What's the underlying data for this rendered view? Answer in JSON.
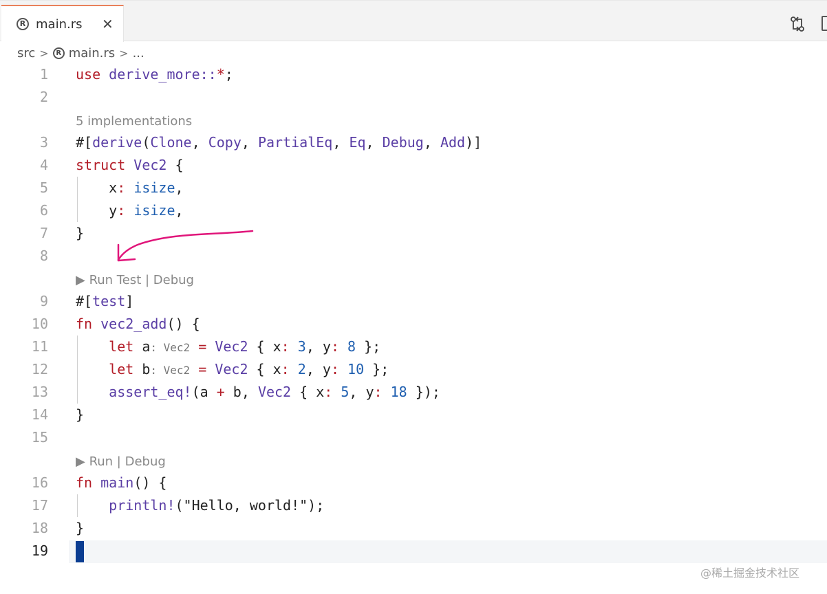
{
  "tab": {
    "icon": "rust-file-icon",
    "label": "main.rs",
    "close": "✕"
  },
  "breadcrumb": {
    "folder": "src",
    "file": "main.rs",
    "more": "..."
  },
  "lens": {
    "impls": "5 implementations",
    "run_test": "▶ Run Test | Debug",
    "run": "▶ Run | Debug"
  },
  "lines": [
    "1",
    "2",
    "3",
    "4",
    "5",
    "6",
    "7",
    "8",
    "9",
    "10",
    "11",
    "12",
    "13",
    "14",
    "15",
    "16",
    "17",
    "18",
    "19"
  ],
  "code": {
    "l1_kw": "use",
    "l1_rest": " derive_more::",
    "l1_star": "*",
    "l1_end": ";",
    "l3_hash": "#[",
    "l3_derive": "derive",
    "l3_open": "(",
    "l3_clone": "Clone",
    "l3_copy": "Copy",
    "l3_peq": "PartialEq",
    "l3_eq": "Eq",
    "l3_debug": "Debug",
    "l3_add": "Add",
    "l3_close": ")]",
    "l4_kw": "struct",
    "l4_ty": "Vec2",
    "l4_brace": " {",
    "l5_field": "    x",
    "l5_type": "isize",
    "l6_field": "    y",
    "l6_type": "isize",
    "l7": "}",
    "l9_hash": "#[",
    "l9_attr": "test",
    "l9_close": "]",
    "l10_kw": "fn",
    "l10_name": "vec2_add",
    "l10_rest": "() {",
    "l11_kw": "let",
    "l11_var": "a",
    "l11_hint": "Vec2",
    "l11_ty": "Vec2",
    "l11_x": "3",
    "l11_y": "8",
    "l12_kw": "let",
    "l12_var": "b",
    "l12_hint": "Vec2",
    "l12_ty": "Vec2",
    "l12_x": "2",
    "l12_y": "10",
    "l13_mac": "assert_eq!",
    "l13_ty": "Vec2",
    "l13_x": "5",
    "l13_y": "18",
    "l14": "}",
    "l16_kw": "fn",
    "l16_name": "main",
    "l16_rest": "() {",
    "l17_mac": "println!",
    "l17_str": "(\"Hello, world!\");",
    "l18": "}"
  },
  "watermark": "@稀土掘金技术社区",
  "colors": {
    "tab_accent": "#e9805a",
    "cursor": "#0b3d91",
    "arrow": "#e0157a"
  }
}
